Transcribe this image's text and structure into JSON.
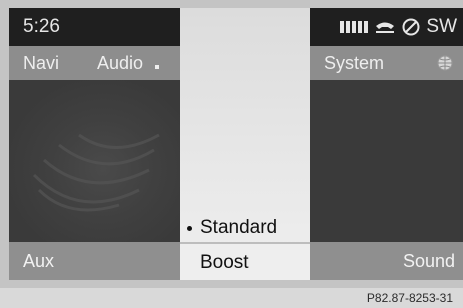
{
  "status_bar": {
    "time": "5:26",
    "right_label": "SW",
    "icons": [
      "signal-strength-icon",
      "phone-icon",
      "no-entry-icon"
    ]
  },
  "left_menu": {
    "navi": "Navi",
    "audio": "Audio"
  },
  "right_menu": {
    "system": "System",
    "icon": "globe-icon"
  },
  "bottom_bar": {
    "left": "Aux",
    "right": "Sound"
  },
  "sound_menu": {
    "items": [
      {
        "label": "Standard",
        "selected": true
      },
      {
        "label": "Boost",
        "selected": false
      }
    ]
  },
  "caption": "P82.87-8253-31"
}
